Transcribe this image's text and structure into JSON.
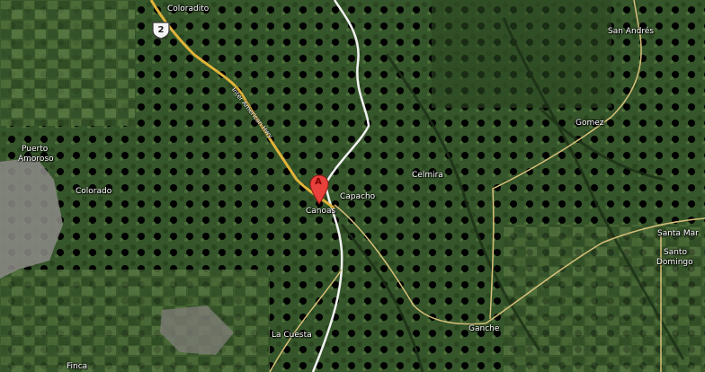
{
  "marker": {
    "letter": "A"
  },
  "highway": {
    "shield_number": "2",
    "name": "Inter American Hwy"
  },
  "places": {
    "coloradito": "Coloradito",
    "san_andres": "San Andrés",
    "gomez": "Gomez",
    "puerto_amoroso_1": "Puerto",
    "puerto_amoroso_2": "Amoroso",
    "colorado": "Colorado",
    "celmira": "Celmira",
    "capacho": "Capacho",
    "canoas": "Canoas",
    "santa_maria": "Santa Mar",
    "santo_domingo_1": "Santo",
    "santo_domingo_2": "Domingo",
    "la_cuesta": "La Cuesta",
    "ganche": "Ganche",
    "finca": "Finca"
  },
  "colors": {
    "terrain_dark": "#243d1d",
    "terrain_mid": "#3f5f30",
    "terrain_light": "#5d7c45",
    "fields": "#6b8a4e",
    "urban": "#8c8b86",
    "highway": "#e0b43a",
    "river": "#f2f2f2",
    "minor_road": "#d7c07a",
    "marker": "#e8403a"
  }
}
